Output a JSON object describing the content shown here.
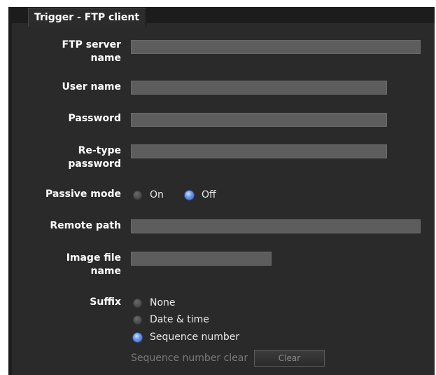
{
  "tab": {
    "title": "Trigger - FTP client"
  },
  "fields": {
    "ftp_server_name": {
      "label_line1": "FTP server",
      "label_line2": "name",
      "value": ""
    },
    "user_name": {
      "label": "User name",
      "value": ""
    },
    "password": {
      "label": "Password",
      "value": ""
    },
    "retype_password": {
      "label_line1": "Re-type",
      "label_line2": "password",
      "value": ""
    },
    "remote_path": {
      "label": "Remote path",
      "value": ""
    },
    "image_file_name": {
      "label_line1": "Image file",
      "label_line2": "name",
      "value": ""
    }
  },
  "passive_mode": {
    "label": "Passive mode",
    "options": [
      {
        "label": "On",
        "checked": false
      },
      {
        "label": "Off",
        "checked": true
      }
    ]
  },
  "suffix": {
    "label": "Suffix",
    "options": [
      {
        "label": "None",
        "checked": false
      },
      {
        "label": "Date & time",
        "checked": false
      },
      {
        "label": "Sequence number",
        "checked": true
      }
    ],
    "sequence_clear_label": "Sequence number clear",
    "clear_button_label": "Clear"
  },
  "colors": {
    "background": "#2a2a2a",
    "field": "#5d5d5d",
    "radio_checked": "#6f9be8"
  }
}
